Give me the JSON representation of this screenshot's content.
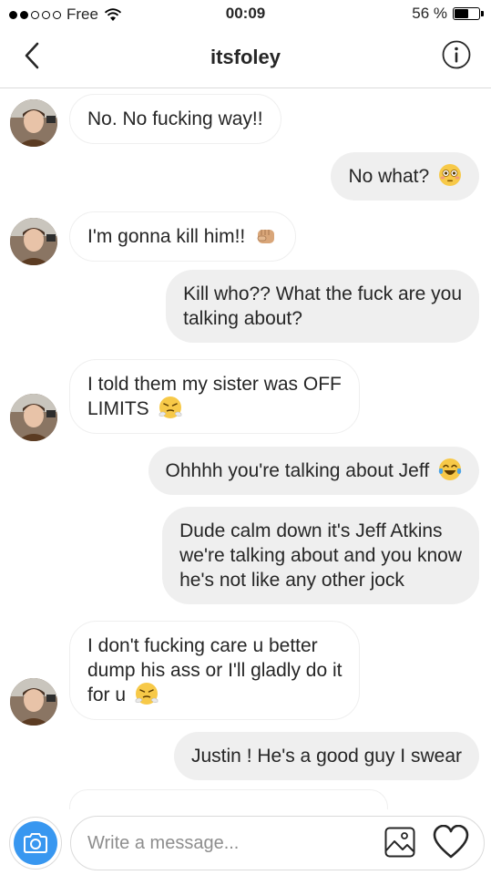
{
  "status_bar": {
    "carrier": "Free",
    "time": "00:09",
    "battery_text": "56 %",
    "battery_level": 0.56
  },
  "header": {
    "title": "itsfoley",
    "back_icon": "chevron-left-icon",
    "info_icon": "info-icon"
  },
  "messages": [
    {
      "side": "in",
      "text": "No. No fucking way!!",
      "emoji": null
    },
    {
      "side": "out",
      "text": "No what?",
      "emoji": "flushed-face"
    },
    {
      "side": "in",
      "text": "I'm gonna kill him!!",
      "emoji": "fist"
    },
    {
      "side": "out",
      "lines": [
        "Kill who?? What the fuck are you",
        "talking about?"
      ]
    },
    {
      "side": "in",
      "lines": [
        "I told them my sister was OFF",
        "LIMITS"
      ],
      "emoji": "steam-face"
    },
    {
      "side": "out",
      "text": "Ohhhh you're talking about Jeff",
      "emoji": "tears-of-joy"
    },
    {
      "side": "out",
      "lines": [
        "Dude calm down it's Jeff Atkins",
        "we're talking about and you know",
        "he's not like any other jock"
      ]
    },
    {
      "side": "in",
      "lines": [
        "I don't fucking care u better",
        "dump his ass or I'll gladly do it",
        "for u"
      ],
      "emoji": "steam-face"
    },
    {
      "side": "out",
      "text": "Justin ! He's a good guy I swear"
    }
  ],
  "composer": {
    "placeholder": "Write a message...",
    "camera_icon": "camera-icon",
    "gallery_icon": "image-icon",
    "like_icon": "heart-icon",
    "accent_color": "#3897f0"
  }
}
